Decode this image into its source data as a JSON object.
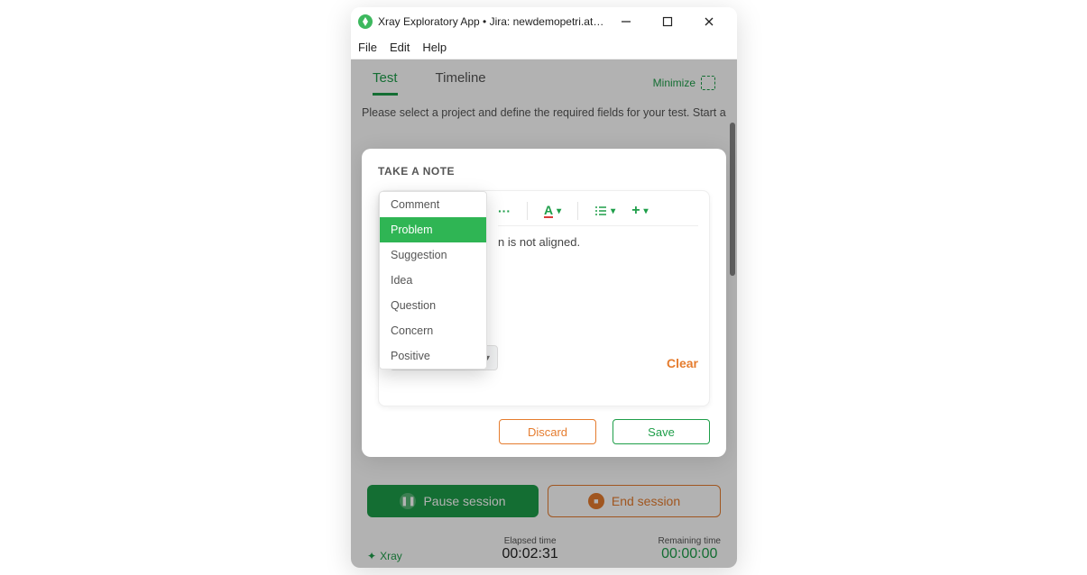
{
  "window": {
    "title": "Xray Exploratory App • Jira: newdemopetri.atla..."
  },
  "menu": {
    "file": "File",
    "edit": "Edit",
    "help": "Help"
  },
  "tabs": {
    "test": "Test",
    "timeline": "Timeline",
    "minimize": "Minimize"
  },
  "instruction": "Please select a project and define the required fields for your test. Start a",
  "modal": {
    "title": "TAKE A NOTE",
    "editor_text": "n is not aligned.",
    "note_type_label": "Problem",
    "clear": "Clear",
    "discard": "Discard",
    "save": "Save",
    "toolbar": {
      "more": "···",
      "color": "A",
      "list": "☰",
      "add": "+"
    },
    "dropdown": [
      {
        "label": "Comment"
      },
      {
        "label": "Problem",
        "selected": true
      },
      {
        "label": "Suggestion"
      },
      {
        "label": "Idea"
      },
      {
        "label": "Question"
      },
      {
        "label": "Concern"
      },
      {
        "label": "Positive"
      }
    ]
  },
  "session": {
    "pause": "Pause session",
    "end": "End session"
  },
  "footer": {
    "brand": "Xray",
    "elapsed_label": "Elapsed time",
    "elapsed": "00:02:31",
    "remaining_label": "Remaining time",
    "remaining": "00:00:00"
  }
}
